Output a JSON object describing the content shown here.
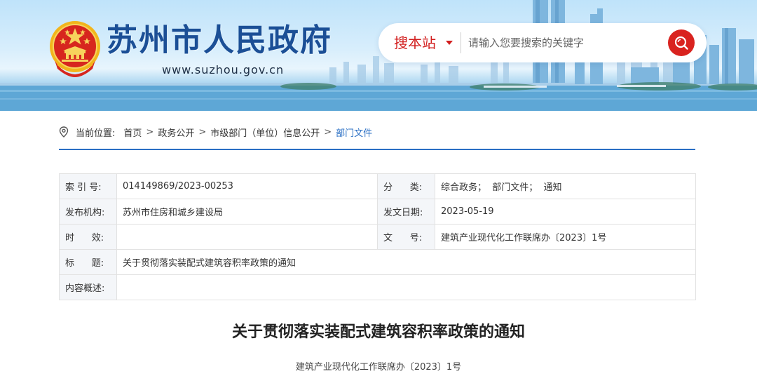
{
  "header": {
    "site_title": "苏州市人民政府",
    "site_url": "www.suzhou.gov.cn",
    "emblem_icon": "national-emblem-icon",
    "search": {
      "scope_label": "搜本站",
      "placeholder": "请输入您要搜索的关键字",
      "button_icon": "search-icon"
    }
  },
  "breadcrumb": {
    "label": "当前位置:",
    "items": [
      "首页",
      "政务公开",
      "市级部门（单位）信息公开",
      "部门文件"
    ],
    "separator": ">"
  },
  "info": {
    "index_no_label": "索 引 号:",
    "index_no": "014149869/2023-00253",
    "category_label": "分      类:",
    "category": "综合政务；  部门文件；  通知",
    "publisher_label": "发布机构:",
    "publisher": "苏州市住房和城乡建设局",
    "issue_date_label": "发文日期:",
    "issue_date": "2023-05-19",
    "validity_label": "时      效:",
    "validity": "",
    "doc_no_label": "文      号:",
    "doc_no": "建筑产业现代化工作联席办〔2023〕1号",
    "subject_label": "标      题:",
    "subject": "关于贯彻落实装配式建筑容积率政策的通知",
    "summary_label": "内容概述:",
    "summary": ""
  },
  "article": {
    "title": "关于贯彻落实装配式建筑容积率政策的通知",
    "doc_no": "建筑产业现代化工作联席办〔2023〕1号"
  },
  "colors": {
    "title_blue": "#1b4f96",
    "accent_red": "#d9231f",
    "link_blue": "#2a6fc4"
  }
}
